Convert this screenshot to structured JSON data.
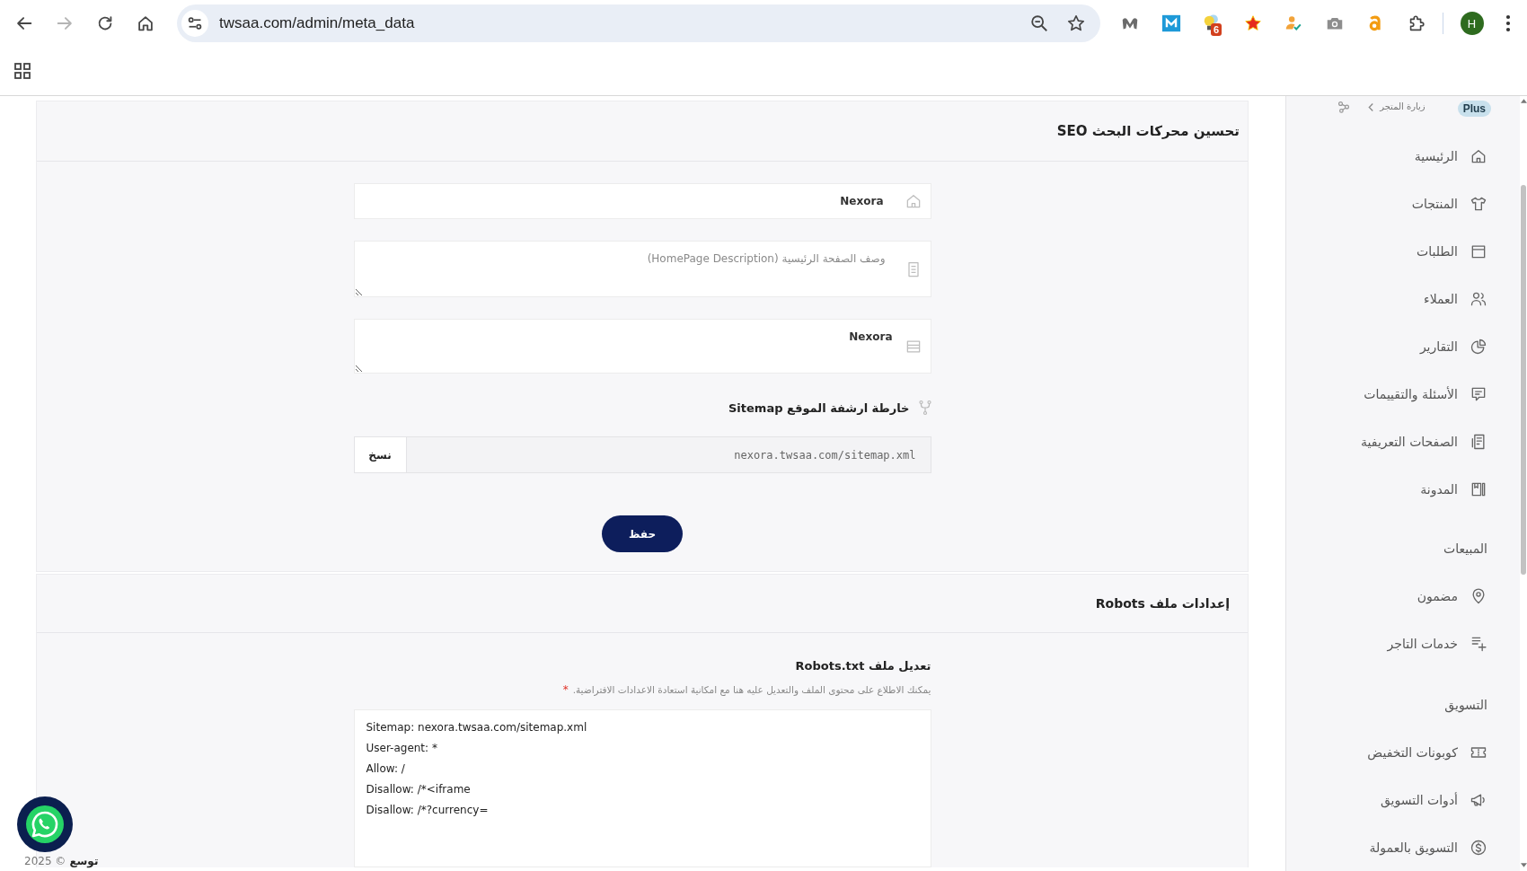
{
  "browser": {
    "nav_buttons": [
      {
        "kind": "back",
        "disabled": false
      },
      {
        "kind": "forward",
        "disabled": true
      },
      {
        "kind": "reload",
        "disabled": false
      },
      {
        "kind": "home",
        "disabled": false
      }
    ],
    "url": "twsaa.com/admin/meta_data",
    "extension_badge": "6",
    "profile_initial": "H"
  },
  "seo_section": {
    "title": "تحسين محركات البحث SEO",
    "fields": [
      {
        "kind": "input",
        "value": "Nexora"
      },
      {
        "kind": "textarea",
        "placeholder": "وصف الصفحة الرئيسية (HomePage Description)"
      },
      {
        "kind": "textarea",
        "value": "Nexora"
      }
    ],
    "sitemap": {
      "label": "خارطة ارشفة الموقع Sitemap",
      "url": "nexora.twsaa.com/sitemap.xml",
      "copy_button": "نسخ"
    },
    "save_button": "حفظ"
  },
  "robots_section": {
    "title": "إعدادات ملف Robots",
    "editor_label": "تعديل ملف Robots.txt",
    "hint": "يمكنك الاطلاع على محتوى الملف والتعديل عليه هنا مع امكانية استعادة الاعدادات الافتراضية.",
    "required_mark": "*",
    "content": "Sitemap: nexora.twsaa.com/sitemap.xml\nUser-agent: *\nAllow: /\nDisallow: /*<iframe\nDisallow: /*?currency="
  },
  "sidebar": {
    "visit_store": "زيارة المتجر",
    "plan_badge": "Plus",
    "groups": [
      {
        "items": [
          {
            "label": "الرئيسية",
            "selected": false
          },
          {
            "label": "المنتجات",
            "selected": false
          },
          {
            "label": "الطلبات",
            "selected": false
          },
          {
            "label": "العملاء",
            "selected": false
          },
          {
            "label": "التقارير",
            "selected": false
          },
          {
            "label": "الأسئلة والتقييمات",
            "selected": false
          },
          {
            "label": "الصفحات التعريفية",
            "selected": false
          },
          {
            "label": "المدونة",
            "selected": false
          }
        ]
      },
      {
        "title": "المبيعات",
        "items": [
          {
            "label": "مضمون",
            "selected": false
          },
          {
            "label": "خدمات التاجر",
            "selected": false
          }
        ]
      },
      {
        "title": "التسويق",
        "items": [
          {
            "label": "كوبونات التخفيض",
            "selected": false
          },
          {
            "label": "أدوات التسويق",
            "selected": false
          },
          {
            "label": "التسويق بالعمولة",
            "selected": false
          }
        ]
      }
    ]
  },
  "footer": {
    "brand": "توسع",
    "copyright": "© 2025"
  }
}
